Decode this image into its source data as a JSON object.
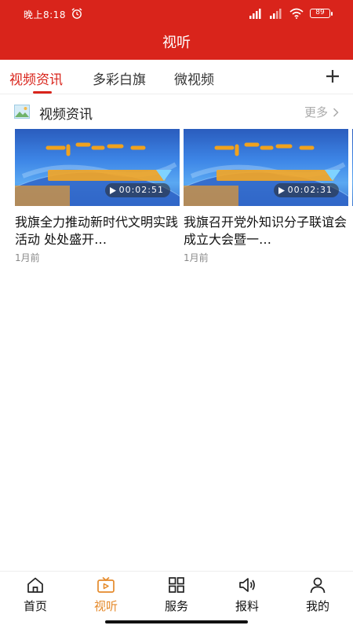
{
  "status_bar": {
    "time": "晚上8:18",
    "battery": "89"
  },
  "header": {
    "title": "视听"
  },
  "tabs": [
    {
      "label": "视频资讯",
      "active": true
    },
    {
      "label": "多彩白旗",
      "active": false
    },
    {
      "label": "微视频",
      "active": false
    }
  ],
  "section": {
    "title": "视频资讯",
    "more_label": "更多"
  },
  "videos": [
    {
      "title": "我旗全力推动新时代文明实践活动  处处盛开…",
      "time": "1月前",
      "duration": "00:02:51"
    },
    {
      "title": "我旗召开党外知识分子联谊会成立大会暨一…",
      "time": "1月前",
      "duration": "00:02:31"
    }
  ],
  "bottom_nav": [
    {
      "label": "首页",
      "icon": "home-icon",
      "active": false
    },
    {
      "label": "视听",
      "icon": "tv-icon",
      "active": true
    },
    {
      "label": "服务",
      "icon": "grid-icon",
      "active": false
    },
    {
      "label": "报料",
      "icon": "speaker-icon",
      "active": false
    },
    {
      "label": "我的",
      "icon": "person-icon",
      "active": false
    }
  ],
  "colors": {
    "brand_red": "#d9241b",
    "active_nav": "#e58a2b",
    "muted_text": "#888888"
  }
}
